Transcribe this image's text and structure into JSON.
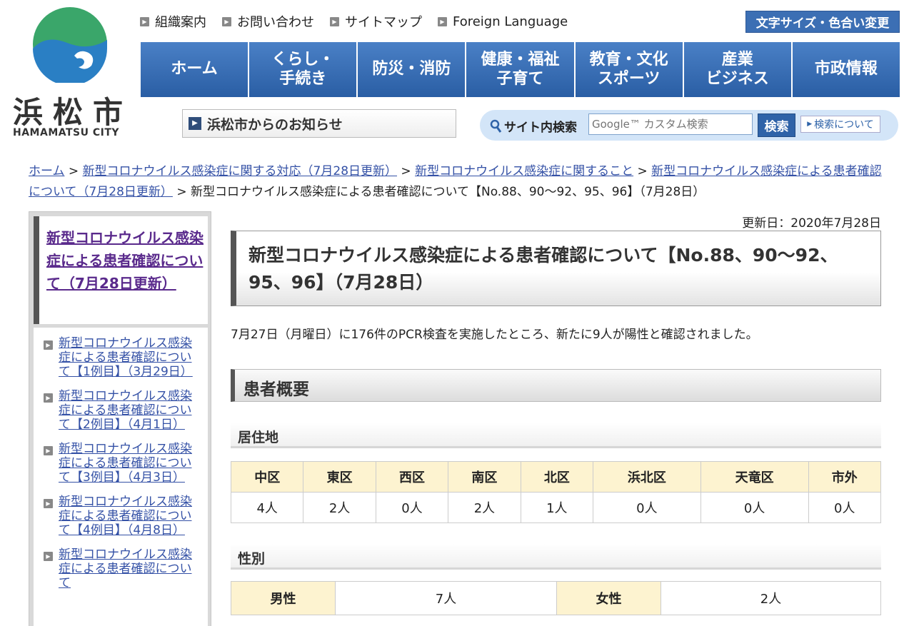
{
  "logo": {
    "name_jp": "浜松市",
    "name_en": "HAMAMATSU CITY"
  },
  "top_links": [
    "組織案内",
    "お問い合わせ",
    "サイトマップ",
    "Foreign Language"
  ],
  "font_size_button": "文字サイズ・色合い変更",
  "global_nav": [
    "ホーム",
    "くらし・\n手続き",
    "防災・消防",
    "健康・福祉\n子育て",
    "教育・文化\nスポーツ",
    "産業\nビジネス",
    "市政情報"
  ],
  "notice_button": "浜松市からのお知らせ",
  "search": {
    "label": "サイト内検索",
    "placeholder": "Google™ カスタム検索",
    "button": "検索",
    "about": "検索について"
  },
  "breadcrumb": {
    "links": [
      "ホーム",
      "新型コロナウイルス感染症に関する対応（7月28日更新）",
      "新型コロナウイルス感染症に関すること",
      "新型コロナウイルス感染症による患者確認について（7月28日更新）"
    ],
    "separator": " > ",
    "current": "新型コロナウイルス感染症による患者確認について【No.88、90～92、95、96】（7月28日）"
  },
  "sidenav": {
    "current": "新型コロナウイルス感染症による患者確認について（7月28日更新）",
    "items": [
      "新型コロナウイルス感染症による患者確認について【1例目】（3月29日）",
      "新型コロナウイルス感染症による患者確認について【2例目】（4月1日）",
      "新型コロナウイルス感染症による患者確認について【3例目】（4月3日）",
      "新型コロナウイルス感染症による患者確認について【4例目】（4月8日）",
      "新型コロナウイルス感染症による患者確認について"
    ]
  },
  "updated": "更新日：2020年7月28日",
  "page_title": "新型コロナウイルス感染症による患者確認について【No.88、90～92、95、96】（7月28日）",
  "lead": "7月27日（月曜日）に176件のPCR検査を実施したところ、新たに9人が陽性と確認されました。",
  "section_title": "患者概要",
  "residence": {
    "heading": "居住地",
    "columns": [
      "中区",
      "東区",
      "西区",
      "南区",
      "北区",
      "浜北区",
      "天竜区",
      "市外"
    ],
    "values": [
      "4人",
      "2人",
      "0人",
      "2人",
      "1人",
      "0人",
      "0人",
      "0人"
    ]
  },
  "sex": {
    "heading": "性別",
    "male_label": "男性",
    "male_value": "7人",
    "female_label": "女性",
    "female_value": "2人"
  },
  "colors": {
    "nav_blue": "#2f63a8",
    "link": "#3451a6",
    "table_header": "#fdf3d0",
    "logo_green": "#3aa66a"
  }
}
